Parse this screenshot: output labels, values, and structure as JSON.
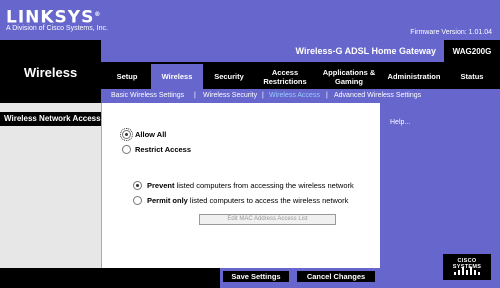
{
  "header": {
    "logo_text": "LINKSYS",
    "logo_registered": "®",
    "logo_tagline": "A Division of Cisco Systems, Inc.",
    "firmware_text": "Firmware Version: 1.01.04",
    "product_name": "Wireless-G ADSL Home Gateway",
    "model": "WAG200G",
    "section_title": "Wireless"
  },
  "tabs": [
    {
      "label": "Setup"
    },
    {
      "label": "Wireless"
    },
    {
      "label": "Security"
    },
    {
      "label": "Access Restrictions"
    },
    {
      "label": "Applications & Gaming"
    },
    {
      "label": "Administration"
    },
    {
      "label": "Status"
    }
  ],
  "subtabs": [
    {
      "label": "Basic Wireless Settings"
    },
    {
      "label": "Wireless Security"
    },
    {
      "label": "Wireless Access"
    },
    {
      "label": "Advanced Wireless Settings"
    }
  ],
  "subtab_separator": "|",
  "active_tab_index": 1,
  "active_subtab_index": 2,
  "sidebar": {
    "title": "Wireless Network Access"
  },
  "main": {
    "allow_all_label": "Allow All",
    "allow_all_selected": true,
    "restrict_access_label": "Restrict Access",
    "restrict_access_selected": false,
    "prevent_strong": "Prevent",
    "prevent_rest": " listed computers from accessing the wireless network",
    "prevent_selected": true,
    "permit_strong": "Permit only",
    "permit_rest": " listed computers to access the wireless network",
    "permit_selected": false,
    "edit_mac_button": "Edit MAC Address Access List"
  },
  "help": {
    "link_text": "Help..."
  },
  "footer": {
    "save_label": "Save Settings",
    "cancel_label": "Cancel Changes",
    "cisco_logo_text": "CISCO SYSTEMS"
  },
  "colors": {
    "brand_purple": "#6666cc",
    "black": "#000000",
    "active_subtab": "#99ccff",
    "left_panel_gray": "#e7e7e7"
  }
}
